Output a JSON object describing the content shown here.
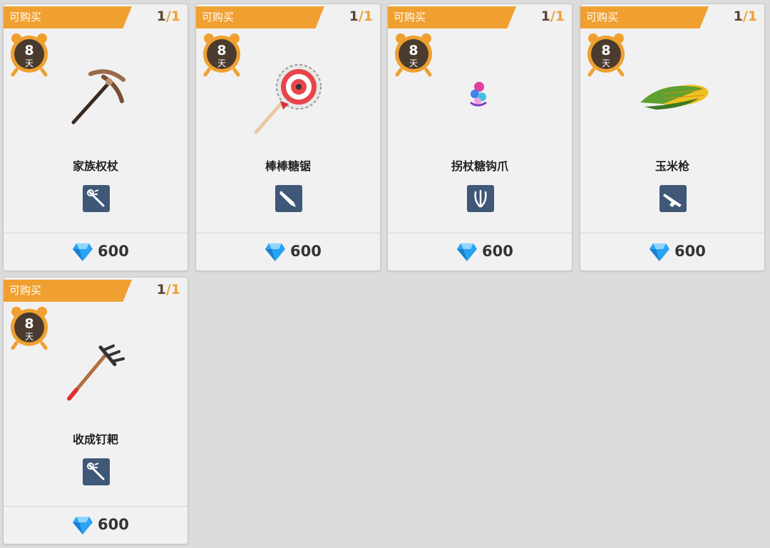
{
  "cards": [
    {
      "status": "可购买",
      "count_current": "1",
      "count_total": "1",
      "timer_value": "8",
      "timer_unit": "天",
      "name": "家族权杖",
      "type_icon": "staff-weapon-icon",
      "item_icon": "family-scepter-pickaxe-icon",
      "currency_icon": "blue-gem-icon",
      "price": "600"
    },
    {
      "status": "可购买",
      "count_current": "1",
      "count_total": "1",
      "timer_value": "8",
      "timer_unit": "天",
      "name": "棒棒糖锯",
      "type_icon": "blade-weapon-icon",
      "item_icon": "lollipop-saw-icon",
      "currency_icon": "blue-gem-icon",
      "price": "600"
    },
    {
      "status": "可购买",
      "count_current": "1",
      "count_total": "1",
      "timer_value": "8",
      "timer_unit": "天",
      "name": "拐杖糖钩爪",
      "type_icon": "claw-weapon-icon",
      "item_icon": "candy-cane-claw-icon",
      "currency_icon": "blue-gem-icon",
      "price": "600"
    },
    {
      "status": "可购买",
      "count_current": "1",
      "count_total": "1",
      "timer_value": "8",
      "timer_unit": "天",
      "name": "玉米枪",
      "type_icon": "gun-weapon-icon",
      "item_icon": "corn-gun-icon",
      "currency_icon": "blue-gem-icon",
      "price": "600"
    },
    {
      "status": "可购买",
      "count_current": "1",
      "count_total": "1",
      "timer_value": "8",
      "timer_unit": "天",
      "name": "收成钉耙",
      "type_icon": "staff-weapon-icon",
      "item_icon": "harvest-rake-icon",
      "currency_icon": "blue-gem-icon",
      "price": "600"
    }
  ],
  "colors": {
    "tag": "#f0a030",
    "timer": "#f0a030",
    "timer_face": "#4a3b2e",
    "type_icon_bg": "#3f5878",
    "gem": "#2aa3f0"
  }
}
